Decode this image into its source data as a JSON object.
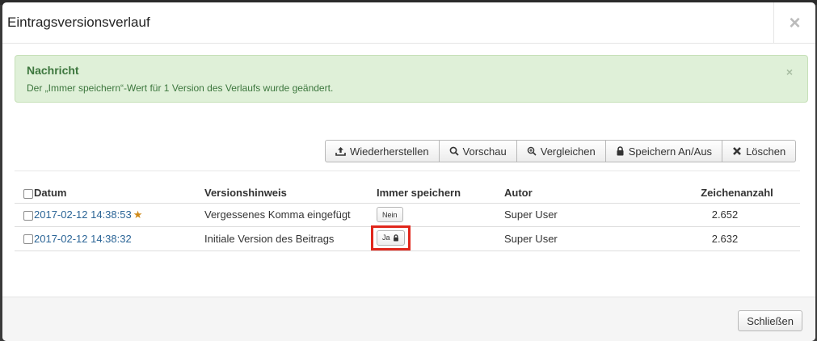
{
  "modal": {
    "title": "Eintragsversionsverlauf",
    "close_symbol": "×"
  },
  "alert": {
    "heading": "Nachricht",
    "message": "Der „Immer speichern“-Wert für 1 Version des Verlaufs wurde geändert.",
    "close_symbol": "×",
    "color": "#dff0d8"
  },
  "toolbar": {
    "buttons": [
      {
        "label": "Wiederherstellen",
        "icon": "upload-icon"
      },
      {
        "label": "Vorschau",
        "icon": "search-icon"
      },
      {
        "label": "Vergleichen",
        "icon": "zoom-in-icon"
      },
      {
        "label": "Speichern An/Aus",
        "icon": "lock-icon"
      },
      {
        "label": "Löschen",
        "icon": "close-icon"
      }
    ]
  },
  "table": {
    "headers": {
      "date": "Datum",
      "note": "Versionshinweis",
      "keep": "Immer speichern",
      "author": "Autor",
      "chars": "Zeichenanzahl"
    },
    "rows": [
      {
        "date": "2017-02-12 14:38:53",
        "current": true,
        "note": "Vergessenes Komma eingefügt",
        "keep": "Nein",
        "keep_locked": false,
        "author": "Super User",
        "chars": "2.652"
      },
      {
        "date": "2017-02-12 14:38:32",
        "current": false,
        "note": "Initiale Version des Beitrags",
        "keep": "Ja",
        "keep_locked": true,
        "author": "Super User",
        "chars": "2.632"
      }
    ]
  },
  "footer": {
    "close_label": "Schließen"
  },
  "colors": {
    "link": "#2a6496",
    "star": "#d08a19",
    "highlight": "#e0261b"
  }
}
